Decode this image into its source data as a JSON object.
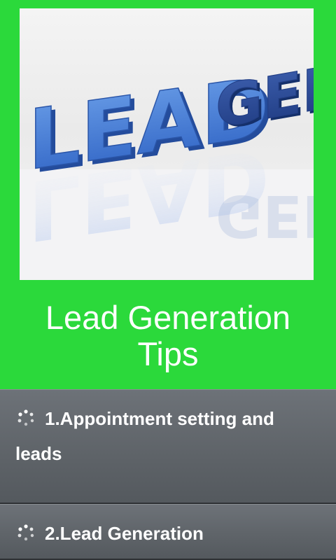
{
  "hero": {
    "icon": "lead-gen-3d-text-image",
    "word1": "LEAD",
    "word2": "GEN"
  },
  "title": {
    "line1": "Lead Generation",
    "line2": "Tips"
  },
  "list": {
    "items": [
      {
        "label": "1.Appointment setting and leads",
        "icon": "spinner-dots-icon"
      },
      {
        "label": "2.Lead Generation",
        "icon": "spinner-dots-icon"
      }
    ]
  },
  "colors": {
    "background": "#2bd93b",
    "list_item": "#62676c",
    "title_text": "#ffffff"
  }
}
